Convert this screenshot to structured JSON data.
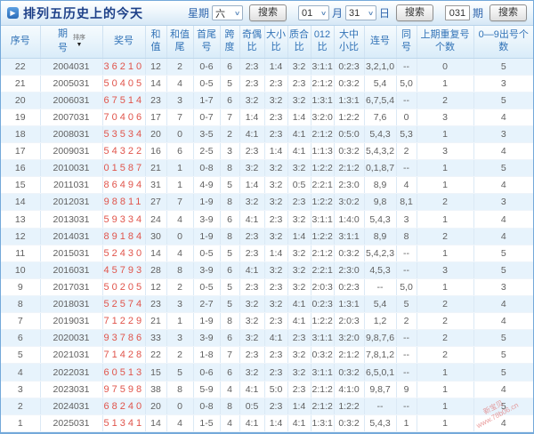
{
  "title": {
    "text": "排列五历史上的今天"
  },
  "search": {
    "week": {
      "label": "星期",
      "value": "六",
      "button": "搜索"
    },
    "date": {
      "month_value": "01",
      "month_label": "月",
      "day_value": "31",
      "day_label": "日",
      "button": "搜索"
    },
    "issue": {
      "value": "031",
      "label": "期",
      "button": "搜索"
    }
  },
  "table": {
    "sort_label": "排序",
    "columns": [
      "序号",
      "期号",
      "奖号",
      "和值",
      "和值尾",
      "首尾号",
      "跨度",
      "奇偶比",
      "大小比",
      "质合比",
      "012比",
      "大中小比",
      "连号",
      "同号",
      "上期重复号个数",
      "0—9出号个数"
    ],
    "column_keys": [
      "index",
      "issue",
      "prize",
      "sum",
      "sum-tail",
      "first-last",
      "span",
      "odd-even",
      "big-small",
      "prime-composite",
      "zero-one-two",
      "big-mid-small",
      "consecutive",
      "same",
      "prev-repeat",
      "digit-count"
    ],
    "rows": [
      [
        "22",
        "2004031",
        "36210",
        "12",
        "2",
        "0-6",
        "6",
        "2:3",
        "1:4",
        "3:2",
        "3:1:1",
        "0:2:3",
        "3,2,1,0",
        "--",
        "0",
        "5"
      ],
      [
        "21",
        "2005031",
        "50405",
        "14",
        "4",
        "0-5",
        "5",
        "2:3",
        "2:3",
        "2:3",
        "2:1:2",
        "0:3:2",
        "5,4",
        "5,0",
        "1",
        "3"
      ],
      [
        "20",
        "2006031",
        "67514",
        "23",
        "3",
        "1-7",
        "6",
        "3:2",
        "3:2",
        "3:2",
        "1:3:1",
        "1:3:1",
        "6,7,5,4",
        "--",
        "2",
        "5"
      ],
      [
        "19",
        "2007031",
        "70406",
        "17",
        "7",
        "0-7",
        "7",
        "1:4",
        "2:3",
        "1:4",
        "3:2:0",
        "1:2:2",
        "7,6",
        "0",
        "3",
        "4"
      ],
      [
        "18",
        "2008031",
        "53534",
        "20",
        "0",
        "3-5",
        "2",
        "4:1",
        "2:3",
        "4:1",
        "2:1:2",
        "0:5:0",
        "5,4,3",
        "5,3",
        "1",
        "3"
      ],
      [
        "17",
        "2009031",
        "54322",
        "16",
        "6",
        "2-5",
        "3",
        "2:3",
        "1:4",
        "4:1",
        "1:1:3",
        "0:3:2",
        "5,4,3,2",
        "2",
        "3",
        "4"
      ],
      [
        "16",
        "2010031",
        "01587",
        "21",
        "1",
        "0-8",
        "8",
        "3:2",
        "3:2",
        "3:2",
        "1:2:2",
        "2:1:2",
        "0,1,8,7",
        "--",
        "1",
        "5"
      ],
      [
        "15",
        "2011031",
        "86494",
        "31",
        "1",
        "4-9",
        "5",
        "1:4",
        "3:2",
        "0:5",
        "2:2:1",
        "2:3:0",
        "8,9",
        "4",
        "1",
        "4"
      ],
      [
        "14",
        "2012031",
        "98811",
        "27",
        "7",
        "1-9",
        "8",
        "3:2",
        "3:2",
        "2:3",
        "1:2:2",
        "3:0:2",
        "9,8",
        "8,1",
        "2",
        "3"
      ],
      [
        "13",
        "2013031",
        "59334",
        "24",
        "4",
        "3-9",
        "6",
        "4:1",
        "2:3",
        "3:2",
        "3:1:1",
        "1:4:0",
        "5,4,3",
        "3",
        "1",
        "4"
      ],
      [
        "12",
        "2014031",
        "89184",
        "30",
        "0",
        "1-9",
        "8",
        "2:3",
        "3:2",
        "1:4",
        "1:2:2",
        "3:1:1",
        "8,9",
        "8",
        "2",
        "4"
      ],
      [
        "11",
        "2015031",
        "52430",
        "14",
        "4",
        "0-5",
        "5",
        "2:3",
        "1:4",
        "3:2",
        "2:1:2",
        "0:3:2",
        "5,4,2,3",
        "--",
        "1",
        "5"
      ],
      [
        "10",
        "2016031",
        "45793",
        "28",
        "8",
        "3-9",
        "6",
        "4:1",
        "3:2",
        "3:2",
        "2:2:1",
        "2:3:0",
        "4,5,3",
        "--",
        "3",
        "5"
      ],
      [
        "9",
        "2017031",
        "50205",
        "12",
        "2",
        "0-5",
        "5",
        "2:3",
        "2:3",
        "3:2",
        "2:0:3",
        "0:2:3",
        "--",
        "5,0",
        "1",
        "3"
      ],
      [
        "8",
        "2018031",
        "52574",
        "23",
        "3",
        "2-7",
        "5",
        "3:2",
        "3:2",
        "4:1",
        "0:2:3",
        "1:3:1",
        "5,4",
        "5",
        "2",
        "4"
      ],
      [
        "7",
        "2019031",
        "71229",
        "21",
        "1",
        "1-9",
        "8",
        "3:2",
        "2:3",
        "4:1",
        "1:2:2",
        "2:0:3",
        "1,2",
        "2",
        "2",
        "4"
      ],
      [
        "6",
        "2020031",
        "93786",
        "33",
        "3",
        "3-9",
        "6",
        "3:2",
        "4:1",
        "2:3",
        "3:1:1",
        "3:2:0",
        "9,8,7,6",
        "--",
        "2",
        "5"
      ],
      [
        "5",
        "2021031",
        "71428",
        "22",
        "2",
        "1-8",
        "7",
        "2:3",
        "2:3",
        "3:2",
        "0:3:2",
        "2:1:2",
        "7,8,1,2",
        "--",
        "2",
        "5"
      ],
      [
        "4",
        "2022031",
        "60513",
        "15",
        "5",
        "0-6",
        "6",
        "3:2",
        "2:3",
        "3:2",
        "3:1:1",
        "0:3:2",
        "6,5,0,1",
        "--",
        "1",
        "5"
      ],
      [
        "3",
        "2023031",
        "97598",
        "38",
        "8",
        "5-9",
        "4",
        "4:1",
        "5:0",
        "2:3",
        "2:1:2",
        "4:1:0",
        "9,8,7",
        "9",
        "1",
        "4"
      ],
      [
        "2",
        "2024031",
        "68240",
        "20",
        "0",
        "0-8",
        "8",
        "0:5",
        "2:3",
        "1:4",
        "2:1:2",
        "1:2:2",
        "--",
        "--",
        "1",
        "5"
      ],
      [
        "1",
        "2025031",
        "51341",
        "14",
        "4",
        "1-5",
        "4",
        "4:1",
        "1:4",
        "4:1",
        "1:3:1",
        "0:3:2",
        "5,4,3",
        "1",
        "1",
        "4"
      ]
    ]
  },
  "watermark": {
    "line1": "新宝贝",
    "line2": "www.78b06.cn"
  },
  "colors": {
    "title_text": "#1d4088",
    "header_blue": "#3273b7",
    "prize_red": "#e0544b",
    "row_alt_bg": "#e7f3fc",
    "border_blue": "#74a9da"
  }
}
